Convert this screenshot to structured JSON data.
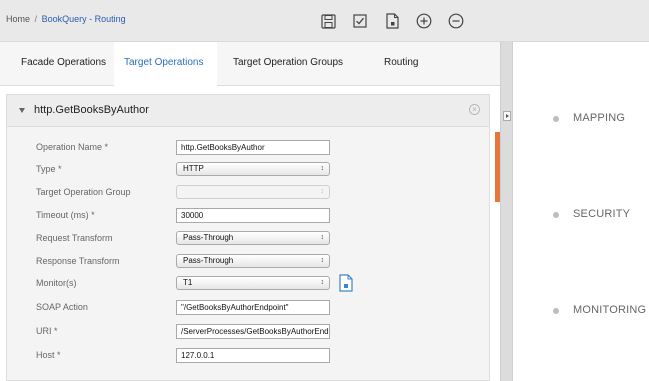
{
  "breadcrumb": {
    "home": "Home",
    "separator": "/",
    "current": "BookQuery - Routing"
  },
  "toolbar": [
    {
      "name": "save-icon"
    },
    {
      "name": "checkbox-icon"
    },
    {
      "name": "document-icon"
    },
    {
      "name": "plus-circle-icon"
    },
    {
      "name": "minus-circle-icon"
    }
  ],
  "tabs": [
    {
      "label": "Facade Operations",
      "active": false
    },
    {
      "label": "Target Operations",
      "active": true
    },
    {
      "label": "Target Operation Groups",
      "active": false
    },
    {
      "label": "Routing",
      "active": false
    }
  ],
  "panel": {
    "title": "http.GetBooksByAuthor",
    "close_glyph": "×",
    "fields": [
      {
        "label": "Operation Name *",
        "kind": "text",
        "value": "http.GetBooksByAuthor"
      },
      {
        "label": "Type *",
        "kind": "select",
        "value": "HTTP"
      },
      {
        "label": "Target Operation Group",
        "kind": "select",
        "value": "",
        "disabled": true
      },
      {
        "label": "Timeout (ms) *",
        "kind": "text",
        "value": "30000"
      },
      {
        "label": "Request Transform",
        "kind": "select",
        "value": "Pass-Through"
      },
      {
        "label": "Response Transform",
        "kind": "select",
        "value": "Pass-Through"
      },
      {
        "label": "Monitor(s)",
        "kind": "select",
        "value": "T1",
        "icon": "document-icon"
      },
      {
        "label": "SOAP Action",
        "kind": "text",
        "value": "\"/GetBooksByAuthorEndpoint\""
      },
      {
        "label": "URI *",
        "kind": "text",
        "value": "/ServerProcesses/GetBooksByAuthorEnd"
      },
      {
        "label": "Host *",
        "kind": "text",
        "value": "127.0.0.1"
      }
    ]
  },
  "select_arrows": "↕",
  "side_nav": [
    {
      "label": "MAPPING"
    },
    {
      "label": "SECURITY"
    },
    {
      "label": "MONITORING"
    }
  ],
  "colors": {
    "accent": "#e6763b",
    "link": "#2a5db0",
    "active_tab": "#2a6fbf"
  }
}
